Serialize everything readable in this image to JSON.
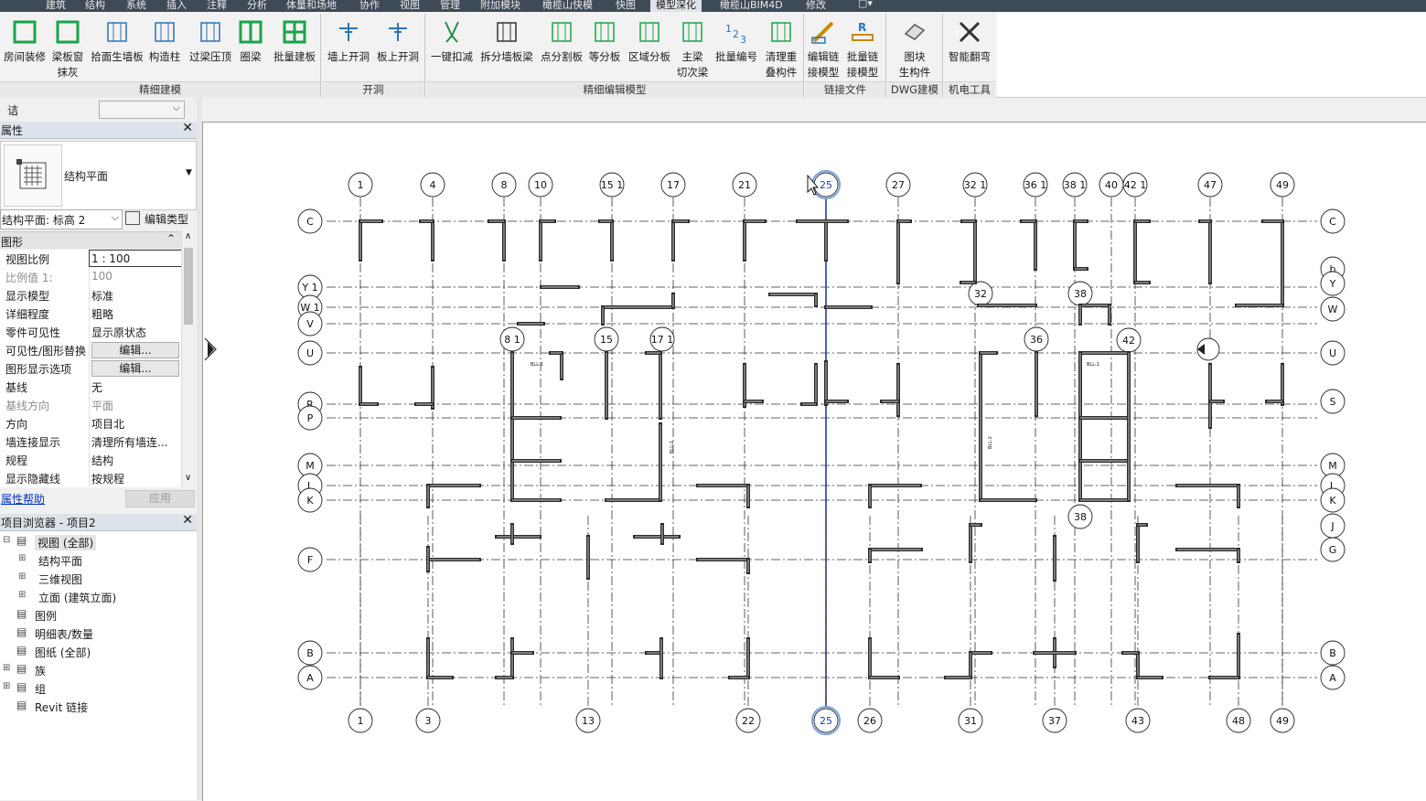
{
  "menu": {
    "items": [
      "建筑",
      "结构",
      "系统",
      "插入",
      "注释",
      "分析",
      "体量和场地",
      "协作",
      "视图",
      "管理",
      "附加模块",
      "橄榄山快模",
      "快图",
      "模型深化",
      "橄榄山BIM4D",
      "修改"
    ],
    "active": "模型深化"
  },
  "ribbon": {
    "buttons": [
      {
        "label": "房间装修",
        "icon": "room-finish-icon"
      },
      {
        "label": "梁板窗\n抹灰",
        "icon": "plaster-icon"
      },
      {
        "label": "拾面生墙板",
        "icon": "wall-panel-icon"
      },
      {
        "label": "构造柱",
        "icon": "constructional-column-icon"
      },
      {
        "label": "过梁压顶",
        "icon": "lintel-icon"
      },
      {
        "label": "圈梁",
        "icon": "ring-beam-icon"
      },
      {
        "label": "批量建板",
        "icon": "batch-slab-icon"
      },
      {
        "label": "墙上开洞",
        "icon": "wall-opening-icon"
      },
      {
        "label": "板上开洞",
        "icon": "slab-opening-icon"
      },
      {
        "label": "一键扣减",
        "icon": "cut-deduct-icon"
      },
      {
        "label": "拆分墙板梁",
        "icon": "split-wall-icon"
      },
      {
        "label": "点分割板",
        "icon": "point-split-icon"
      },
      {
        "label": "等分板",
        "icon": "equal-divide-icon"
      },
      {
        "label": "区域分板",
        "icon": "region-divide-icon"
      },
      {
        "label": "主梁\n切次梁",
        "icon": "beam-cut-icon"
      },
      {
        "label": "批量编号",
        "icon": "numbering-icon"
      },
      {
        "label": "清理重\n叠构件",
        "icon": "cleanup-icon"
      },
      {
        "label": "编辑链\n接模型",
        "icon": "edit-link-icon"
      },
      {
        "label": "批量链\n接模型",
        "icon": "batch-link-icon"
      },
      {
        "label": "图块\n生构件",
        "icon": "block-to-element-icon"
      },
      {
        "label": "智能翻弯",
        "icon": "smart-bend-icon"
      }
    ],
    "groups": [
      "精细建模",
      "开洞",
      "精细编辑模型",
      "链接文件",
      "DWG建模",
      "机电工具"
    ]
  },
  "type_selector": {
    "value": "诘"
  },
  "properties": {
    "title": "属性",
    "family": "结构平面",
    "view_select": "结构平面: 标高 2",
    "edit_type": "编辑类型",
    "section": "图形",
    "rows": [
      {
        "key": "视图比例",
        "value": "1 : 100",
        "style": "input"
      },
      {
        "key": "比例值 1:",
        "value": "100",
        "style": "grey"
      },
      {
        "key": "显示模型",
        "value": "标准"
      },
      {
        "key": "详细程度",
        "value": "粗略"
      },
      {
        "key": "零件可见性",
        "value": "显示原状态"
      },
      {
        "key": "可见性/图形替换",
        "value": "编辑...",
        "style": "button"
      },
      {
        "key": "图形显示选项",
        "value": "编辑...",
        "style": "button"
      },
      {
        "key": "基线",
        "value": "无"
      },
      {
        "key": "基线方向",
        "value": "平面",
        "style": "grey"
      },
      {
        "key": "方向",
        "value": "项目北"
      },
      {
        "key": "墙连接显示",
        "value": "清理所有墙连..."
      },
      {
        "key": "规程",
        "value": "结构"
      },
      {
        "key": "显示隐藏线",
        "value": "按规程"
      }
    ],
    "help": "属性帮助",
    "apply": "应用"
  },
  "browser": {
    "title": "项目浏览器 - 项目2",
    "items": [
      {
        "label": "视图 (全部)",
        "level": 0,
        "expander": "−",
        "selected": true,
        "icon": "views-icon"
      },
      {
        "label": "结构平面",
        "level": 1,
        "expander": "+"
      },
      {
        "label": "三维视图",
        "level": 1,
        "expander": "+"
      },
      {
        "label": "立面 (建筑立面)",
        "level": 1,
        "expander": "+"
      },
      {
        "label": "图例",
        "level": 0,
        "icon": "legend-icon"
      },
      {
        "label": "明细表/数量",
        "level": 0,
        "icon": "schedule-icon"
      },
      {
        "label": "图纸 (全部)",
        "level": 0,
        "icon": "sheet-icon"
      },
      {
        "label": "族",
        "level": 0,
        "expander": "+",
        "icon": "family-icon"
      },
      {
        "label": "组",
        "level": 0,
        "expander": "+",
        "icon": "group-icon"
      },
      {
        "label": "Revit 链接",
        "level": 0,
        "icon": "revit-link-icon"
      }
    ]
  },
  "canvas": {
    "grid_top": [
      "1",
      "4",
      "8",
      "10",
      "15 1",
      "17",
      "21",
      "25",
      "27",
      "32 1",
      "36 1",
      "38 1",
      "40",
      "42 1",
      "47",
      "49"
    ],
    "grid_bottom": [
      "1",
      "3",
      "13",
      "22",
      "25",
      "26",
      "31",
      "37",
      "43",
      "48",
      "49"
    ],
    "grid_left": [
      "C",
      "Y 1",
      "W 1",
      "V",
      "U",
      "R",
      "P",
      "M",
      "L",
      "K",
      "F",
      "B",
      "A"
    ],
    "grid_right": [
      "C",
      "b",
      "Y",
      "W",
      "U",
      "S",
      "M",
      "L",
      "K",
      "J",
      "G",
      "B",
      "A"
    ],
    "grid_inner": [
      "32",
      "38",
      "8 1",
      "15",
      "17 1",
      "36",
      "42",
      "38"
    ],
    "wall_tags": [
      "BLL-1",
      "BLL-2",
      "BLL-1",
      "BLL-2"
    ],
    "selected_grid": "25"
  }
}
